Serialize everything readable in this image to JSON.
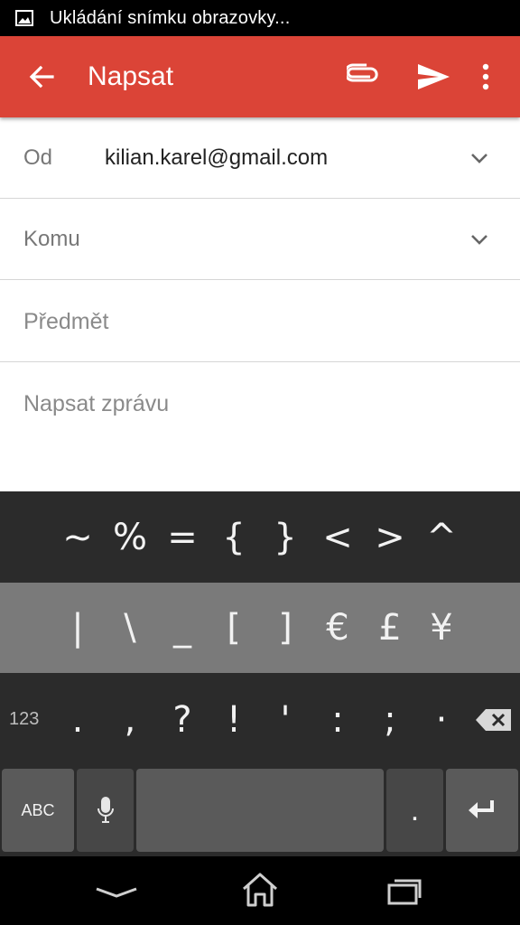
{
  "status_bar": {
    "icon": "image-icon",
    "text": "Ukládání snímku obrazovky..."
  },
  "app_bar": {
    "title": "Napsat",
    "color": "#db4437",
    "icons": [
      "back-arrow-icon",
      "paperclip-icon",
      "send-icon",
      "more-vert-icon"
    ]
  },
  "compose": {
    "from": {
      "label": "Od",
      "value": "kilian.karel@gmail.com"
    },
    "to": {
      "label": "Komu"
    },
    "subject": {
      "placeholder": "Předmět"
    },
    "body": {
      "placeholder": "Napsat zprávu"
    }
  },
  "keyboard": {
    "row1": [
      "~",
      "%",
      "=",
      "{",
      "}",
      "<",
      ">",
      "^"
    ],
    "row2": [
      "|",
      "\\",
      "_",
      "[",
      "]",
      "€",
      "£",
      "¥"
    ],
    "row3_mode": "123",
    "row3": [
      ".",
      ",",
      "?",
      "!",
      "'",
      ":",
      ";",
      "·"
    ],
    "abc_label": "ABC",
    "period_label": ".",
    "icons": [
      "mic-icon",
      "backspace-icon",
      "enter-icon"
    ]
  },
  "nav_bar": {
    "icons": [
      "hide-keyboard-icon",
      "home-icon",
      "recents-icon"
    ]
  }
}
